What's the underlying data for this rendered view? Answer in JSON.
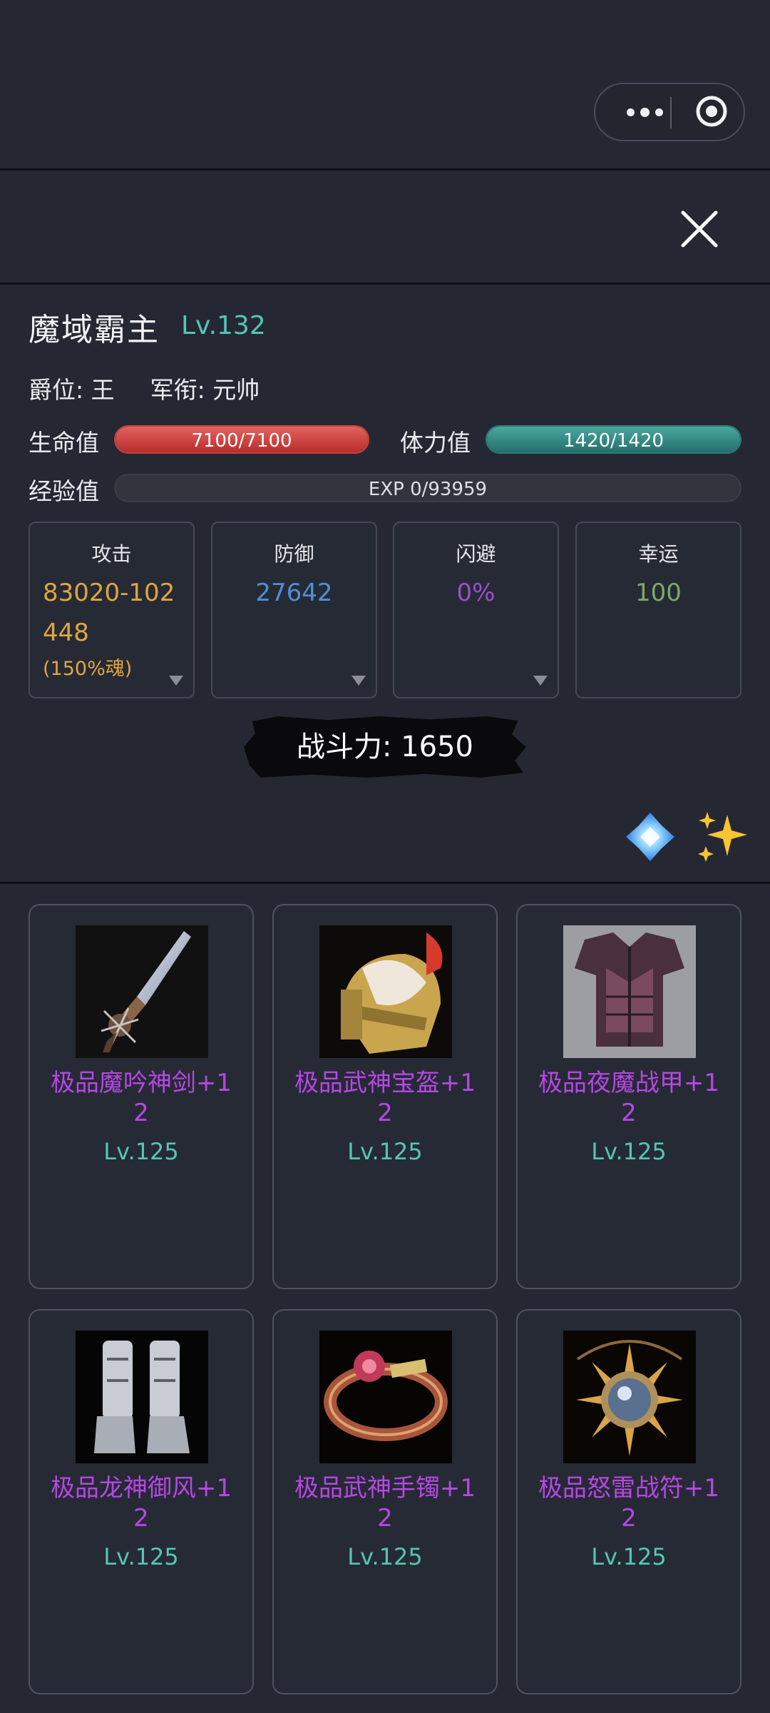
{
  "colors": {
    "accent_teal": "#55c6b5",
    "item_purple": "#b647e4",
    "attack_orange": "#e0a640",
    "defense_blue": "#4d8fd6",
    "dodge_purple": "#9a4fc4",
    "luck_green": "#7fa86a",
    "hp_red": "#c2443f",
    "stamina_teal": "#2b7d77"
  },
  "header": {
    "menu_icon": "more-dots-icon",
    "capsule_close_icon": "target-circle-icon",
    "close_icon": "close-x-icon"
  },
  "character": {
    "name": "魔域霸主",
    "level": "Lv.132",
    "rank": "爵位: 王",
    "title": "军衔: 元帅"
  },
  "bars": {
    "hp_label": "生命值",
    "hp_text": "7100/7100",
    "hp_ratio": 1.0,
    "stamina_label": "体力值",
    "stamina_text": "1420/1420",
    "stamina_ratio": 1.0,
    "exp_label": "经验值",
    "exp_text": "EXP 0/93959",
    "exp_ratio": 0.0
  },
  "stats": {
    "attack_label": "攻击",
    "attack_value": "83020-102448",
    "attack_note": "(150%魂)",
    "defense_label": "防御",
    "defense_value": "27642",
    "dodge_label": "闪避",
    "dodge_value": "0%",
    "luck_label": "幸运",
    "luck_value": "100"
  },
  "power": {
    "text": "战斗力: 1650"
  },
  "actions": {
    "gem_icon": "blue-gem-icon",
    "sparkle_icon": "sparkles-icon"
  },
  "equipment": [
    {
      "name": "极品魔吟神剑+12",
      "level": "Lv.125",
      "icon": "sword-icon"
    },
    {
      "name": "极品武神宝盔+12",
      "level": "Lv.125",
      "icon": "helmet-icon"
    },
    {
      "name": "极品夜魔战甲+12",
      "level": "Lv.125",
      "icon": "armor-icon"
    },
    {
      "name": "极品龙神御风+12",
      "level": "Lv.125",
      "icon": "boots-icon"
    },
    {
      "name": "极品武神手镯+12",
      "level": "Lv.125",
      "icon": "bracelet-icon"
    },
    {
      "name": "极品怒雷战符+12",
      "level": "Lv.125",
      "icon": "amulet-icon"
    }
  ]
}
